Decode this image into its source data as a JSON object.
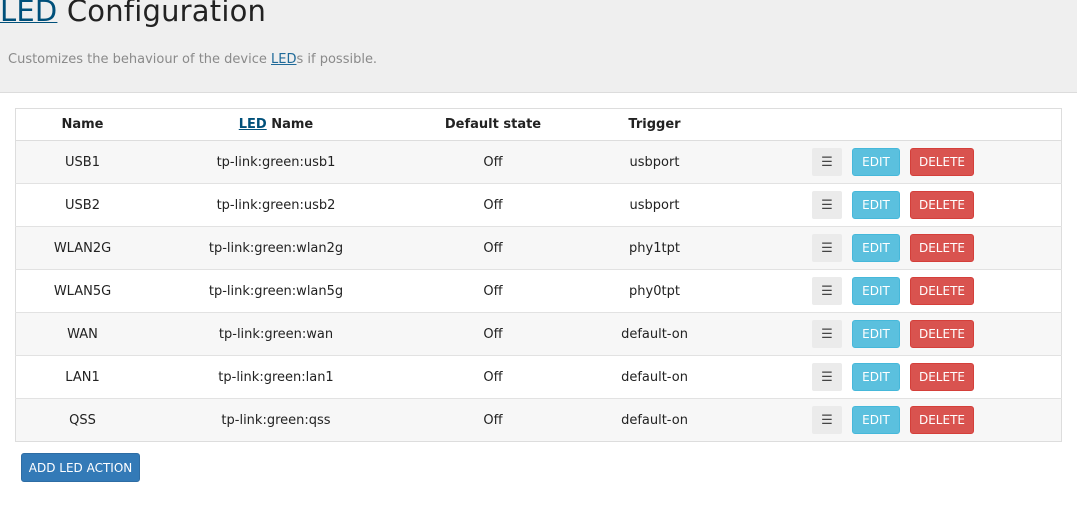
{
  "header": {
    "title_abbr": "LED",
    "title_rest": " Configuration",
    "desc_before": "Customizes the behaviour of the device ",
    "desc_abbr": "LED",
    "desc_after": "s if possible."
  },
  "table": {
    "columns": {
      "name": "Name",
      "led_abbr": "LED",
      "led_rest": " Name",
      "default_state": "Default state",
      "trigger": "Trigger"
    },
    "rows": [
      {
        "name": "USB1",
        "led_name": "tp-link:green:usb1",
        "default_state": "Off",
        "trigger": "usbport"
      },
      {
        "name": "USB2",
        "led_name": "tp-link:green:usb2",
        "default_state": "Off",
        "trigger": "usbport"
      },
      {
        "name": "WLAN2G",
        "led_name": "tp-link:green:wlan2g",
        "default_state": "Off",
        "trigger": "phy1tpt"
      },
      {
        "name": "WLAN5G",
        "led_name": "tp-link:green:wlan5g",
        "default_state": "Off",
        "trigger": "phy0tpt"
      },
      {
        "name": "WAN",
        "led_name": "tp-link:green:wan",
        "default_state": "Off",
        "trigger": "default-on"
      },
      {
        "name": "LAN1",
        "led_name": "tp-link:green:lan1",
        "default_state": "Off",
        "trigger": "default-on"
      },
      {
        "name": "QSS",
        "led_name": "tp-link:green:qss",
        "default_state": "Off",
        "trigger": "default-on"
      }
    ],
    "drag_glyph": "☰",
    "drag_icon": "drag-handle-icon",
    "edit_label": "EDIT",
    "delete_label": "DELETE"
  },
  "add_button_label": "ADD LED ACTION",
  "colors": {
    "edit": "#5bc0de",
    "delete": "#d9534f",
    "add": "#337ab7",
    "link": "#00507a"
  }
}
